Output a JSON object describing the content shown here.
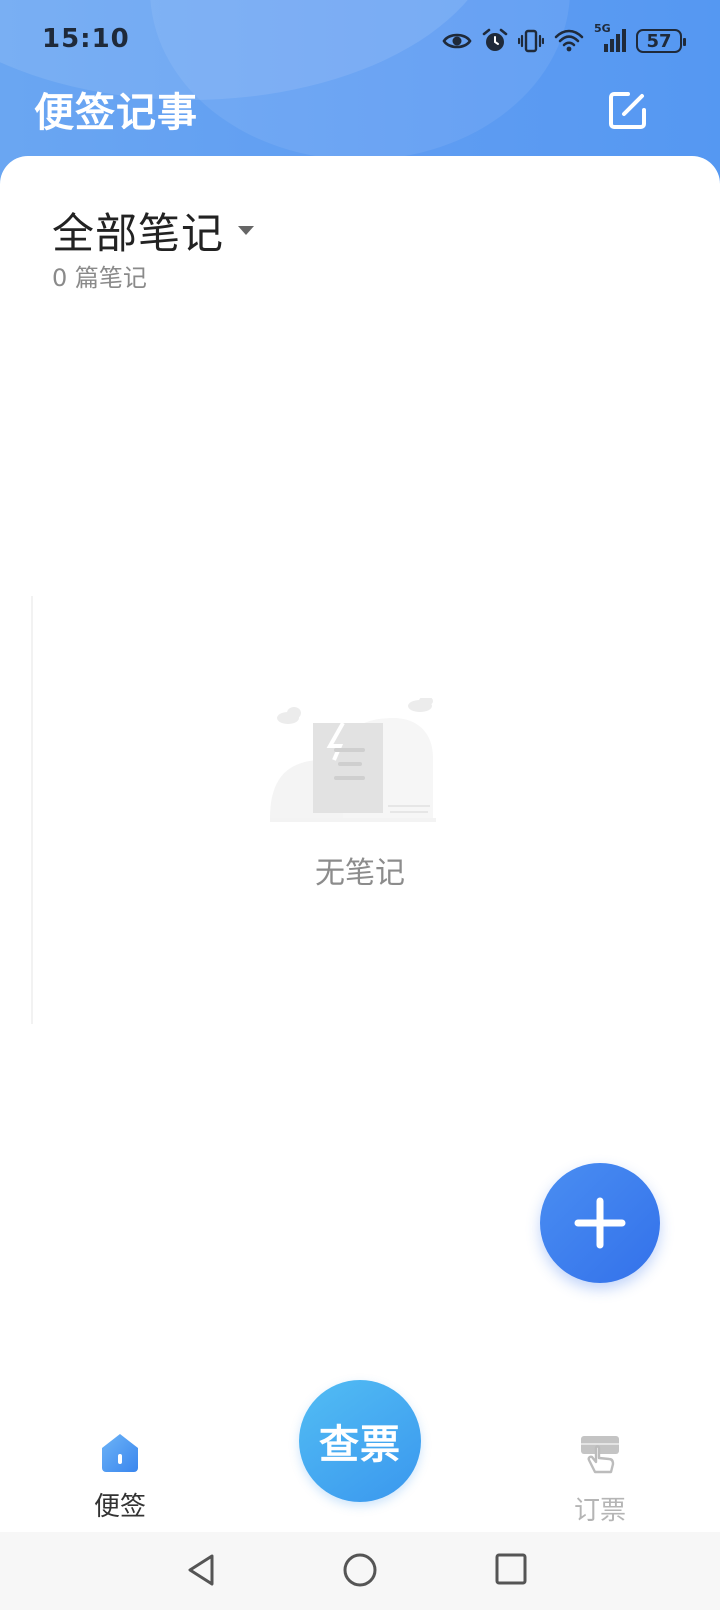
{
  "status_bar": {
    "time": "15:10",
    "network": "5G",
    "battery": "57"
  },
  "header": {
    "title": "便签记事",
    "edit_icon": "edit-icon"
  },
  "folder": {
    "title": "全部笔记",
    "count_text": "0 篇笔记"
  },
  "empty_state": {
    "text": "无笔记",
    "illustration": "empty-notes-illustration"
  },
  "fab": {
    "icon": "plus-icon"
  },
  "bottom_nav": {
    "tabs": [
      {
        "label": "便签",
        "icon": "home-icon",
        "active": true
      },
      {
        "label": "查票",
        "icon": "",
        "active": false
      },
      {
        "label": "订票",
        "icon": "hand-tap-icon",
        "active": false
      }
    ]
  },
  "system_nav": {
    "buttons": [
      "back-icon",
      "home-circle-icon",
      "recents-icon"
    ]
  },
  "colors": {
    "header_bg": "#5e9cf2",
    "fab": "#3a7bed",
    "center_button": "#45a9f1",
    "text_primary": "#222222",
    "text_secondary": "#8a8a8a"
  }
}
